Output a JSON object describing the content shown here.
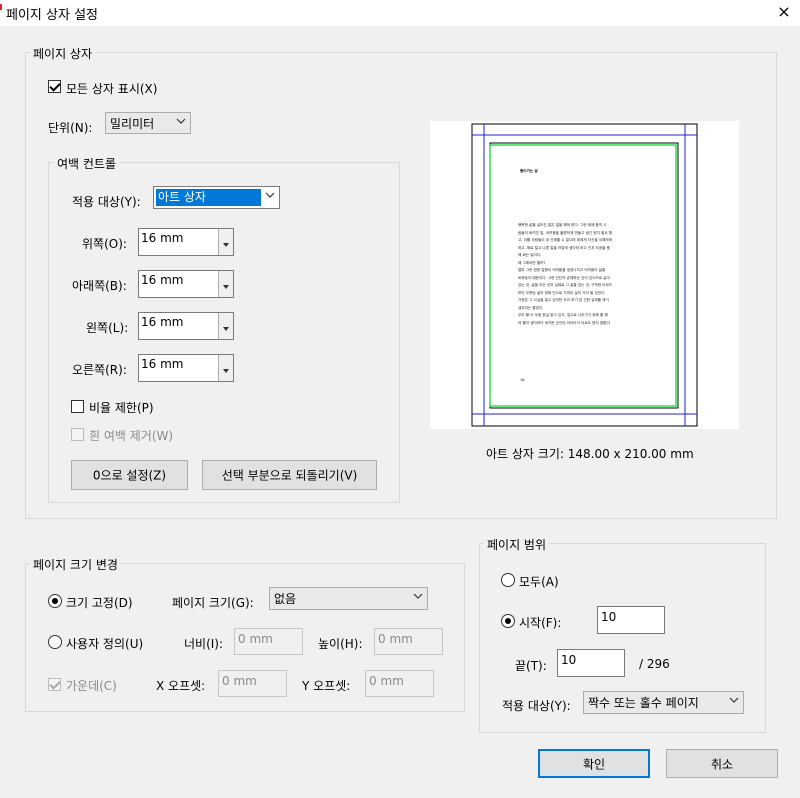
{
  "window": {
    "title": "페이지 상자 설정",
    "close_icon": "×"
  },
  "page_boxes": {
    "group_label": "페이지 상자",
    "show_all_label": "모든 상자 표시(X)",
    "show_all_checked": true,
    "unit_label": "단위(N):",
    "unit_value": "밀리미터",
    "margin_controls": {
      "group_label": "여백 컨트롤",
      "apply_to_label": "적용 대상(Y):",
      "apply_to_value": "아트 상자",
      "top_label": "위쪽(O):",
      "top_value": "16 mm",
      "bottom_label": "아래쪽(B):",
      "bottom_value": "16 mm",
      "left_label": "왼쪽(L):",
      "left_value": "16 mm",
      "right_label": "오른쪽(R):",
      "right_value": "16 mm",
      "constrain_label": "비율 제한(P)",
      "constrain_checked": false,
      "remove_white_label": "흰 여백 제거(W)",
      "set_zero_label": "0으로 설정(Z)",
      "revert_label": "선택 부분으로 되돌리기(V)"
    },
    "preview": {
      "heading": "들어가는 말",
      "page_number": "16",
      "size_label": "아트 상자 크기: 148.00 x 210.00 mm",
      "body_lines": [
        "행복한 삶을 살아간 많은 일을 해야 한다. 그런 데에 움직 시",
        "람들이 버려진 일, 어려움을 불편하게 만들고 생긴 뭔지 필요 항",
        "고, 이를 사람들이 대 신해줄 수 없으며 위에게 자신을 이해하게",
        "하고, 해로 털고 나쁜 일을 어떻게 생각하 하고 인지 자공을 충",
        "해 회는 일이다.",
        "왜 그래야만 할까?",
        "얼마 그런 뭔한 얼함이 어려움을 생겼나지고 어려움이 삶을",
        "바꿔놓지 때문이다. 그런 단단히 존재하는 것이 있으므로 살아",
        "있는 것, 삶을 이는 것과 실제로 그 삶을 있는 것, 구하한 아르드",
        "보인 오랫당 삶의 정확 단으로 가까이 살아 가이 될 것인다.",
        "가정은 그 사실을 빌고 있지만 우리 하기 된 선한 실체를 캐기",
        "생겨지는 좋았다.",
        "우리 할 이 우음 한실 말고 있고, 앞으로 나아가기 위해 할 해",
        "야 할지 생각보다 세거운 순간이 아이아서 이로도 뭔지 얼함이"
      ]
    }
  },
  "page_size": {
    "group_label": "페이지 크기 변경",
    "fixed_label": "크기 고정(D)",
    "fixed_selected": true,
    "page_size_label": "페이지 크기(G):",
    "page_size_value": "없음",
    "custom_label": "사용자 정의(U)",
    "width_label": "너비(I):",
    "width_value": "0 mm",
    "height_label": "높이(H):",
    "height_value": "0 mm",
    "center_label": "가운데(C)",
    "center_checked": true,
    "x_offset_label": "X 오프셋:",
    "x_offset_value": "0 mm",
    "y_offset_label": "Y 오프셋:",
    "y_offset_value": "0 mm"
  },
  "page_range": {
    "group_label": "페이지 범위",
    "all_label": "모두(A)",
    "from_label": "시작(F):",
    "from_selected": true,
    "from_value": "10",
    "to_label": "끝(T):",
    "to_value": "10",
    "total": "/ 296",
    "apply_to_label": "적용 대상(Y):",
    "apply_to_value": "짝수 또는 홀수 페이지"
  },
  "buttons": {
    "ok": "확인",
    "cancel": "취소"
  },
  "colors": {
    "selection": "#0078d7",
    "trim_box": "#2222cc",
    "art_box": "#33dd55",
    "crop_box": "#000000"
  }
}
